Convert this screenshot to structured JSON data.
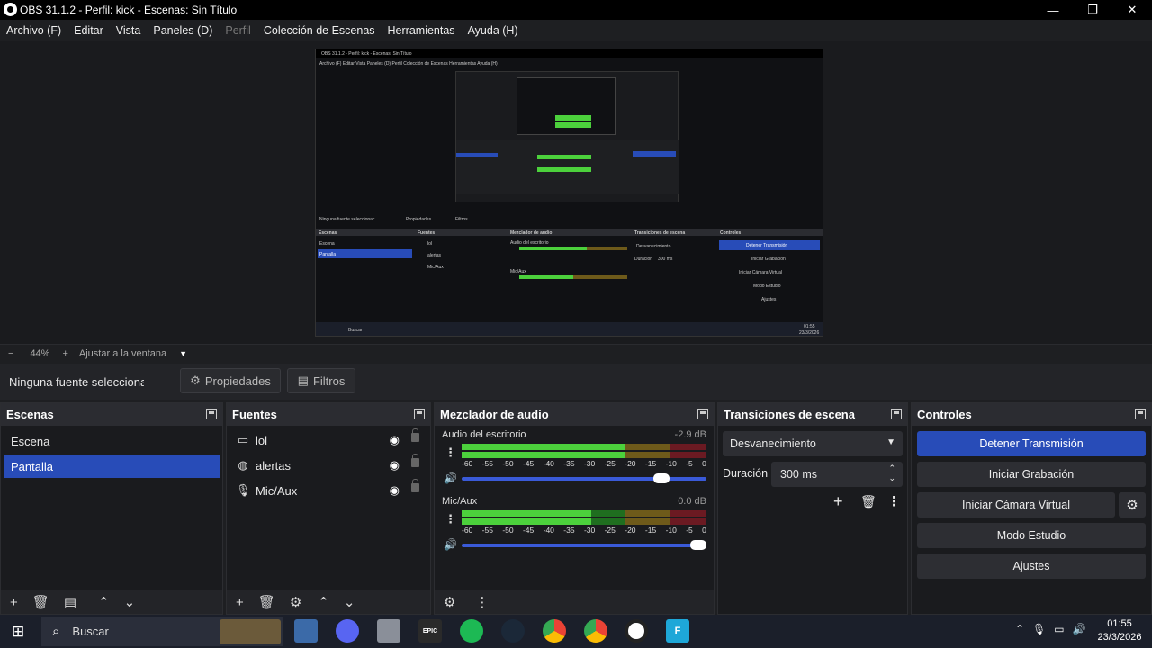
{
  "window": {
    "title": "OBS 31.1.2 - Perfil: kick - Escenas: Sin Título"
  },
  "menu": [
    "Archivo (F)",
    "Editar",
    "Vista",
    "Paneles (D)",
    "Perfil",
    "Colección de Escenas",
    "Herramientas",
    "Ayuda (H)"
  ],
  "zoom": {
    "minus": "−",
    "value": "44%",
    "plus": "+",
    "fit_label": "Ajustar a la ventana"
  },
  "source_toolbar": {
    "no_selection": "Ninguna fuente seleccionac",
    "properties": "Propiedades",
    "filters": "Filtros"
  },
  "scenes": {
    "title": "Escenas",
    "items": [
      "Escena",
      "Pantalla"
    ],
    "selected": "Pantalla"
  },
  "sources": {
    "title": "Fuentes",
    "items": [
      {
        "name": "lol",
        "icon": "monitor-icon"
      },
      {
        "name": "alertas",
        "icon": "globe-icon"
      },
      {
        "name": "Mic/Aux",
        "icon": "microphone-icon"
      }
    ]
  },
  "mixer": {
    "title": "Mezclador de audio",
    "channels": [
      {
        "name": "Audio del escritorio",
        "db": "-2.9 dB",
        "level": 0.67,
        "peak": 0.93,
        "volume": 0.85
      },
      {
        "name": "Mic/Aux",
        "db": "0.0 dB",
        "level": 0.53,
        "peak": 0.53,
        "volume": 1.0
      }
    ],
    "scale": [
      "-60",
      "-55",
      "-50",
      "-45",
      "-40",
      "-35",
      "-30",
      "-25",
      "-20",
      "-15",
      "-10",
      "-5",
      "0"
    ]
  },
  "transitions": {
    "title": "Transiciones de escena",
    "selected": "Desvanecimiento",
    "duration_label": "Duración",
    "duration_value": "300 ms"
  },
  "controls": {
    "title": "Controles",
    "stop_stream": "Detener Transmisión",
    "start_recording": "Iniciar Grabación",
    "start_virtual_cam": "Iniciar Cámara Virtual",
    "studio_mode": "Modo Estudio",
    "settings": "Ajustes"
  },
  "taskbar": {
    "search_placeholder": "Buscar",
    "time": "01:55",
    "date": "23/3/2026"
  },
  "preview_mini": {
    "title": "OBS 31.1.2 - Perfil: kick - Escenas: Sin Título",
    "menu": "Archivo (F)   Editar   Vista   Paneles (D)   Perfil   Colección de Escenas   Herramientas   Ayuda (H)",
    "no_selection": "Ninguna fuente seleccionac",
    "props": "Propiedades",
    "filters": "Filtros",
    "scenes": "Escenas",
    "scene1": "Escena",
    "scene2": "Pantalla",
    "sources": "Fuentes",
    "src1": "lol",
    "src2": "alertas",
    "src3": "Mic/Aux",
    "mixer": "Mezclador de audio",
    "ch1": "Audio del escritorio",
    "ch2": "Mic/Aux",
    "trans": "Transiciones de escena",
    "fade": "Desvanecimiento",
    "dur": "Duración",
    "durv": "300 ms",
    "controls": "Controles",
    "c1": "Detener Transmisión",
    "c2": "Iniciar Grabación",
    "c3": "Iniciar Cámara Virtual",
    "c4": "Modo Estudio",
    "c5": "Ajustes",
    "search": "Buscar",
    "time": "01:55",
    "date": "23/3/2026"
  },
  "colors": {
    "accent": "#284cb8",
    "meter_green": "#4cd13c",
    "bg": "#1e1f22"
  }
}
